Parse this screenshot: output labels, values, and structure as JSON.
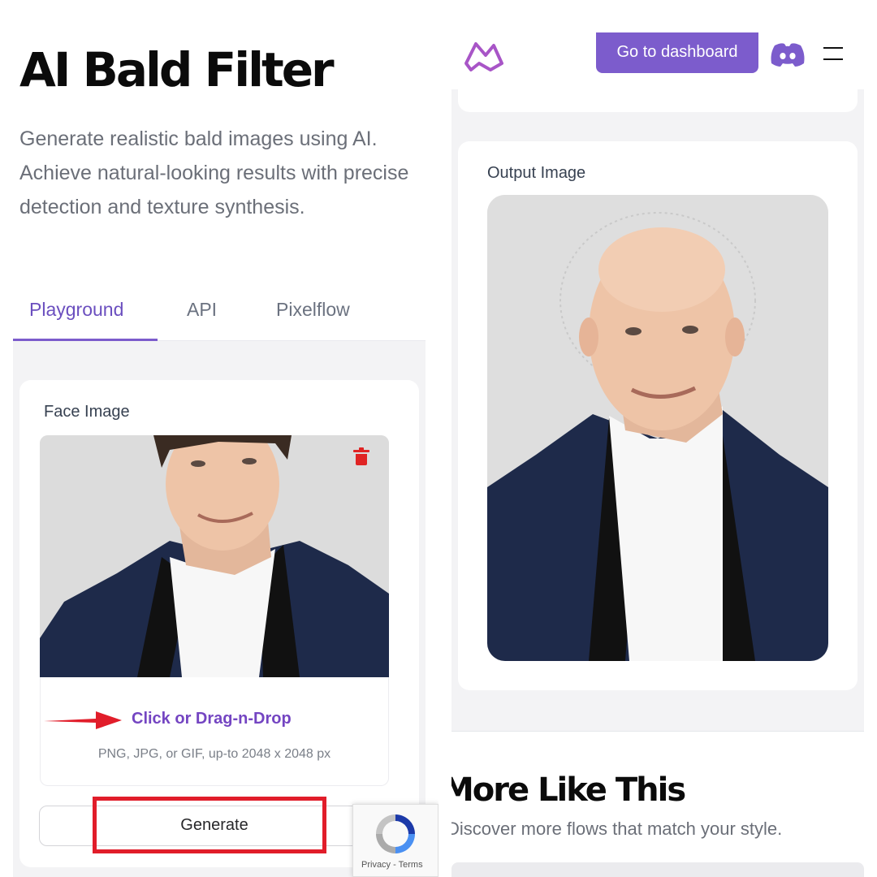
{
  "left_panel": {
    "title": "AI Bald Filter",
    "subtitle": "Generate realistic bald images using AI. Achieve natural-looking results with precise detection and texture synthesis.",
    "tabs": [
      {
        "label": "Playground",
        "active": true
      },
      {
        "label": "API",
        "active": false
      },
      {
        "label": "Pixelflow",
        "active": false
      }
    ],
    "face_card": {
      "label": "Face Image",
      "photo": "uploaded-face-photo",
      "delete_icon": "trash-icon",
      "drop_text": "Click or Drag-n-Drop",
      "drop_hint": "PNG, JPG, or GIF, up-to 2048 x 2048 px"
    },
    "generate_label": "Generate",
    "annotations": {
      "arrow_color": "#e11d2a",
      "highlight_color": "#e11d2a"
    },
    "recaptcha_text": "Privacy - Terms"
  },
  "right_panel": {
    "header": {
      "logo": "brand-logo-icon",
      "dashboard_label": "Go to dashboard",
      "discord_icon": "discord-icon",
      "menu_icon": "hamburger-menu-icon"
    },
    "output_card": {
      "label": "Output Image",
      "photo": "bald-output-photo"
    },
    "more_title": "More Like This",
    "more_subtitle": "Discover more flows that match your style."
  },
  "colors": {
    "accent": "#7c5ccc",
    "accent_text": "#7445c2",
    "panel_bg": "#f3f3f5",
    "delete": "#e02424"
  }
}
